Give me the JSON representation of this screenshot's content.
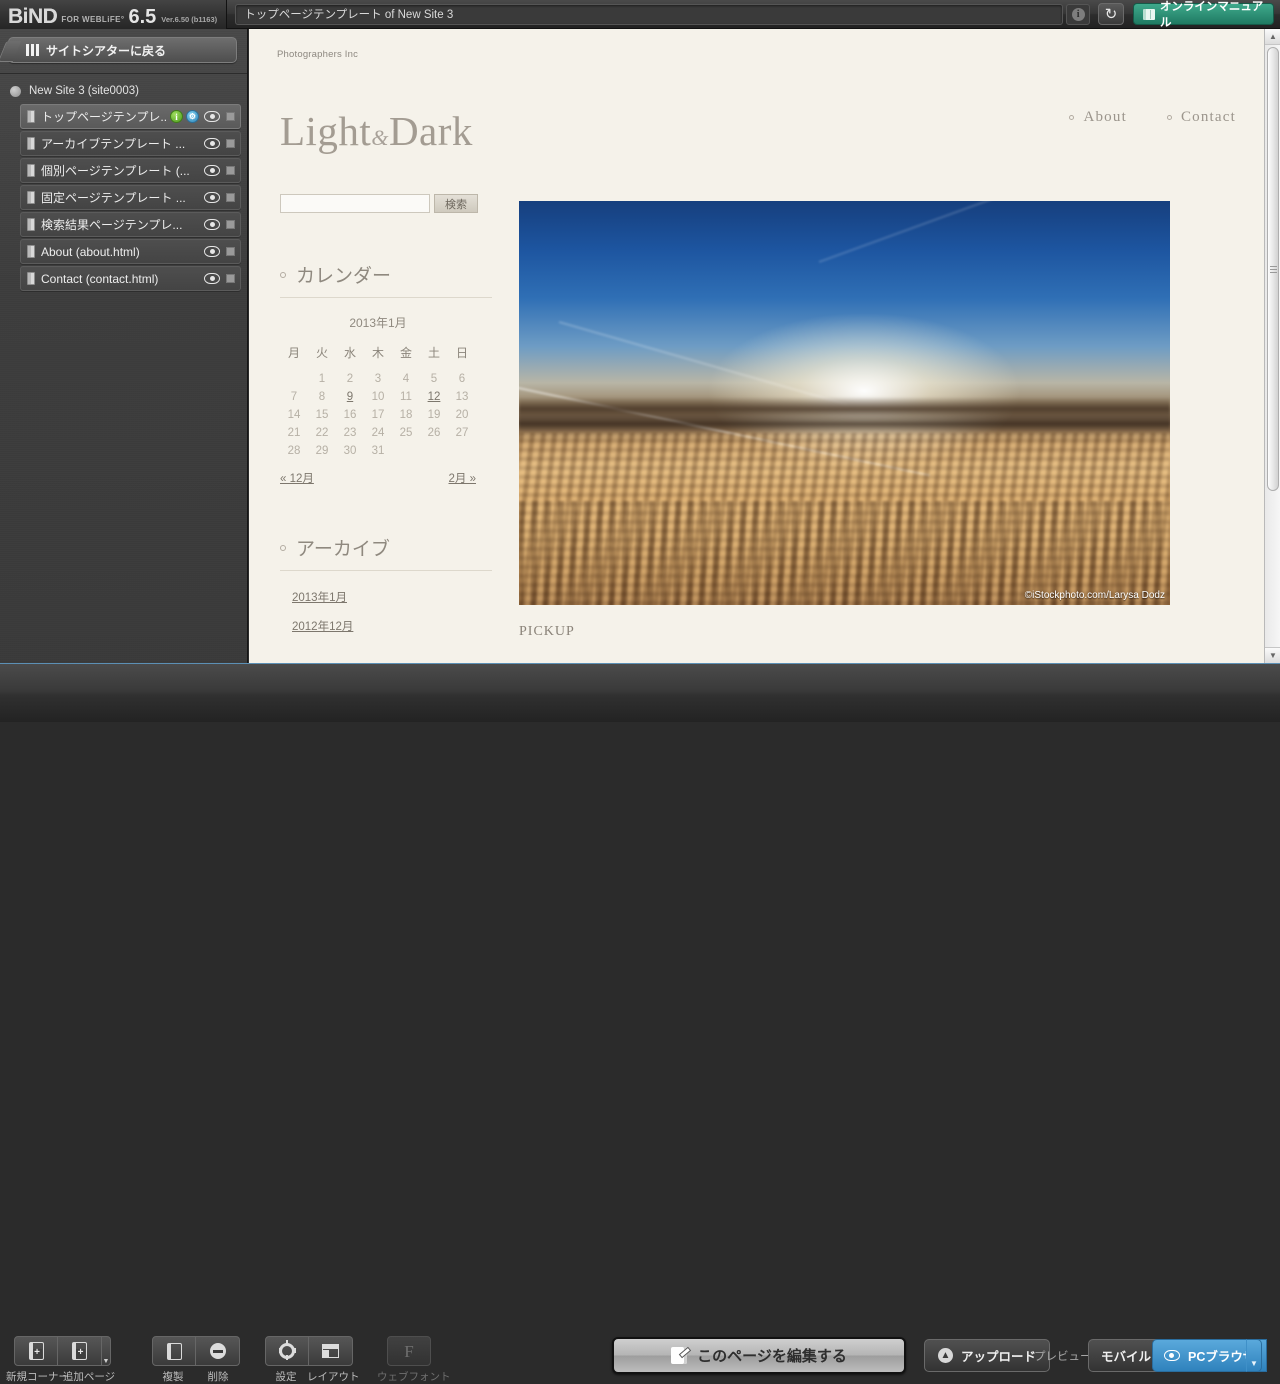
{
  "app": {
    "logo_name": "BiND",
    "logo_sub": "FOR WEBLiFE°",
    "logo_version_big": "6.5",
    "logo_version_small": "Ver.6.50 (b1163)"
  },
  "topbar": {
    "document_title": "トップページテンプレート of New Site 3",
    "info_icon": "info-icon",
    "reload_icon": "reload-icon",
    "manual_label": "オンラインマニュアル",
    "manual_icon": "book-icon"
  },
  "sidebar": {
    "back_button": "サイトシアターに戻る",
    "site_name": "New Site 3 (site0003)",
    "pages": [
      {
        "label": "トップページテンプレ...",
        "selected": true,
        "badges": [
          "info",
          "gear"
        ]
      },
      {
        "label": "アーカイブテンプレート ...",
        "selected": false,
        "badges": []
      },
      {
        "label": "個別ページテンプレート (...",
        "selected": false,
        "badges": []
      },
      {
        "label": "固定ページテンプレート ...",
        "selected": false,
        "badges": []
      },
      {
        "label": "検索結果ページテンプレ...",
        "selected": false,
        "badges": []
      },
      {
        "label": "About (about.html)",
        "selected": false,
        "badges": []
      },
      {
        "label": "Contact (contact.html)",
        "selected": false,
        "badges": []
      }
    ]
  },
  "site": {
    "tagline": "Photographers Inc",
    "title_part1": "Light",
    "title_amp": "&",
    "title_part2": "Dark",
    "nav": [
      {
        "label": "About"
      },
      {
        "label": "Contact"
      }
    ],
    "search": {
      "value": "",
      "placeholder": "",
      "button_label": "検索"
    },
    "calendar_widget": {
      "heading": "カレンダー",
      "caption": "2013年1月",
      "weekdays": [
        "月",
        "火",
        "水",
        "木",
        "金",
        "土",
        "日"
      ],
      "weeks": [
        [
          "",
          "1",
          "2",
          "3",
          "4",
          "5",
          "6"
        ],
        [
          "7",
          "8",
          "9",
          "10",
          "11",
          "12",
          "13"
        ],
        [
          "14",
          "15",
          "16",
          "17",
          "18",
          "19",
          "20"
        ],
        [
          "21",
          "22",
          "23",
          "24",
          "25",
          "26",
          "27"
        ],
        [
          "28",
          "29",
          "30",
          "31",
          "",
          "",
          ""
        ]
      ],
      "linked_days": [
        "9",
        "12"
      ],
      "prev_label": "« 12月",
      "next_label": "2月 »"
    },
    "archive_widget": {
      "heading": "アーカイブ",
      "items": [
        "2013年1月",
        "2012年12月"
      ]
    },
    "hero": {
      "credit": "©iStockphoto.com/Larysa Dodz",
      "alt": "sunset above clouds from airplane"
    },
    "pickup_heading": "PICKUP"
  },
  "bottombar": {
    "tools_left": [
      {
        "label": "新規コーナー",
        "icon": "new-corner-icon",
        "disabled": false
      },
      {
        "label": "追加ページ",
        "icon": "add-page-icon",
        "disabled": false
      },
      {
        "label": "複製",
        "icon": "duplicate-icon",
        "disabled": false
      },
      {
        "label": "削除",
        "icon": "delete-icon",
        "disabled": false
      }
    ],
    "tools_mid": [
      {
        "label": "設定",
        "icon": "gear-icon",
        "disabled": false
      },
      {
        "label": "レイアウト",
        "icon": "layout-icon",
        "disabled": false
      },
      {
        "label": "ウェブフォント",
        "icon": "webfont-icon",
        "disabled": true
      }
    ],
    "edit_button": "このページを編集する",
    "upload_button": "アップロード",
    "preview_label": "プレビュー",
    "mobile_button": "モバイル",
    "pc_button": "PCブラウザ"
  },
  "colors": {
    "accent_blue": "#2f82bd",
    "manual_green": "#1f7a62",
    "canvas_bg": "#f5f2ea"
  }
}
